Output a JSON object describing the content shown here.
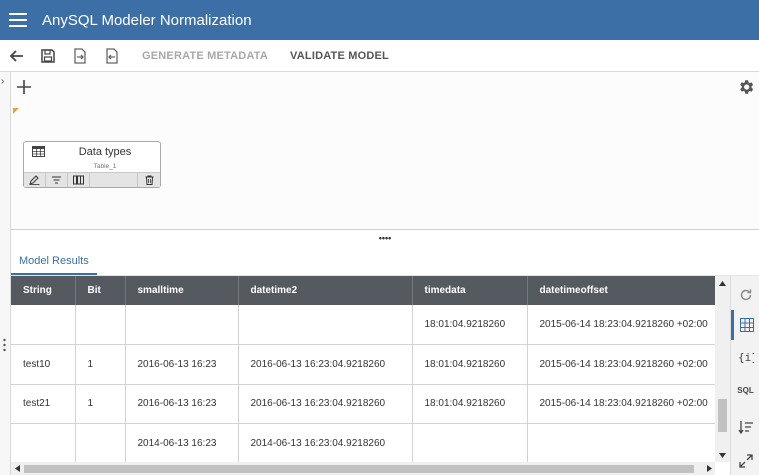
{
  "app": {
    "title": "AnySQL Modeler Normalization"
  },
  "toolbar": {
    "generate_metadata": "GENERATE METADATA",
    "validate_model": "VALIDATE MODEL"
  },
  "canvas": {
    "entity": {
      "name": "Data types",
      "subtitle": "Table_1"
    }
  },
  "results": {
    "tab_label": "Model Results",
    "columns": [
      "String",
      "Bit",
      "smalltime",
      "datetime2",
      "timedata",
      "datetimeoffset"
    ],
    "rows": [
      [
        "",
        "",
        "",
        "",
        "18:01:04.9218260",
        "2015-06-14 18:23:04.9218260 +02:00"
      ],
      [
        "test10",
        "1",
        "2016-06-13 16:23",
        "2016-06-13 16:23:04.9218260",
        "18:01:04.9218260",
        "2015-06-14 18:23:04.9218260 +02:00"
      ],
      [
        "test21",
        "1",
        "2016-06-13 16:23",
        "2016-06-13 16:23:04.9218260",
        "18:01:04.9218260",
        "2015-06-14 18:23:04.9218260 +02:00"
      ],
      [
        "",
        "",
        "2014-06-13 16:23",
        "2014-06-13 16:23:04.9218260",
        "",
        ""
      ]
    ]
  },
  "side_panel": {
    "sql_label": "SQL"
  },
  "colors": {
    "accent": "#3c6fa6",
    "header_dark": "#555a60"
  }
}
